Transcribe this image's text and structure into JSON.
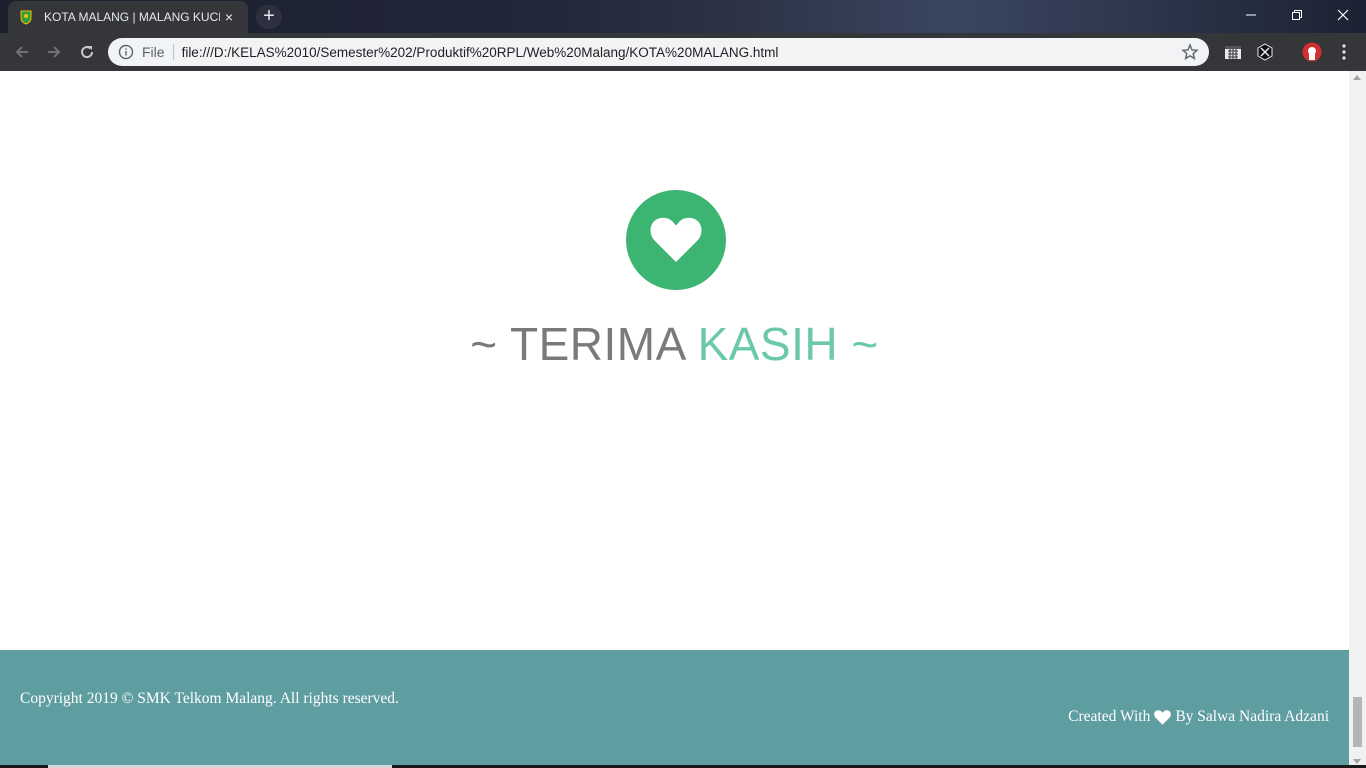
{
  "browser": {
    "tab_title": "KOTA MALANG | MALANG KUCECWARA",
    "tab_close": "×",
    "new_tab": "+",
    "file_label": "File",
    "url": "file:///D:/KELAS%2010/Semester%202/Produktif%20RPL/Web%20Malang/KOTA%20MALANG.html"
  },
  "page": {
    "thanks_prefix": "~ TERIMA",
    "thanks_highlight": "KASIH ~",
    "footer": {
      "copyright": "Copyright 2019 © SMK Telkom Malang. All rights reserved.",
      "created_with": "Created With",
      "created_by": "By Salwa Nadira Adzani"
    }
  },
  "colors": {
    "heart_circle": "#3db572",
    "footer_bg": "#5f9ea0",
    "thanks_grey": "#7a7a7a",
    "thanks_green": "#6cc9a8"
  }
}
